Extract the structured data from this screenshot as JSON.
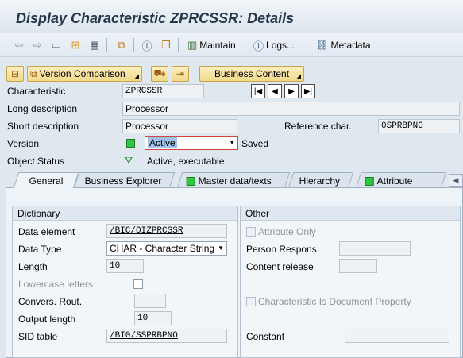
{
  "title": "Display Characteristic ZPRCSSR: Details",
  "toolbar": {
    "maintain_label": "Maintain",
    "logs_label": "Logs...",
    "metadata_label": "Metadata"
  },
  "toolbar2": {
    "version_comparison_label": "Version Comparison",
    "business_content_label": "Business Content"
  },
  "header": {
    "characteristic_label": "Characteristic",
    "characteristic_value": "ZPRCSSR",
    "long_desc_label": "Long description",
    "long_desc_value": "Processor",
    "short_desc_label": "Short description",
    "short_desc_value": "Processor",
    "ref_char_label": "Reference char.",
    "ref_char_value": "0SPRBPNO",
    "version_label": "Version",
    "version_value": "Active",
    "version_status": "Saved",
    "object_status_label": "Object Status",
    "object_status_value": "Active, executable"
  },
  "tabs": [
    {
      "label": "General"
    },
    {
      "label": "Business Explorer"
    },
    {
      "label": "Master data/texts"
    },
    {
      "label": "Hierarchy"
    },
    {
      "label": "Attribute"
    }
  ],
  "dictionary": {
    "title": "Dictionary",
    "data_element_label": "Data element",
    "data_element_value": "/BIC/OIZPRCSSR",
    "data_type_label": "Data Type",
    "data_type_value": "CHAR - Character String",
    "length_label": "Length",
    "length_value": "10",
    "lowercase_label": "Lowercase letters",
    "convers_label": "Convers. Rout.",
    "convers_value": "",
    "output_length_label": "Output length",
    "output_length_value": "10",
    "sid_table_label": "SID table",
    "sid_table_value": "/BI0/SSPRBPNO"
  },
  "other": {
    "title": "Other",
    "attribute_only_label": "Attribute Only",
    "person_respons_label": "Person Respons.",
    "content_release_label": "Content release",
    "char_doc_property_label": "Characteristic Is Document Property",
    "constant_label": "Constant"
  },
  "colors": {
    "accent_yellow": "#f2d98a",
    "status_green": "#2ec840",
    "title_text": "#27374b"
  }
}
